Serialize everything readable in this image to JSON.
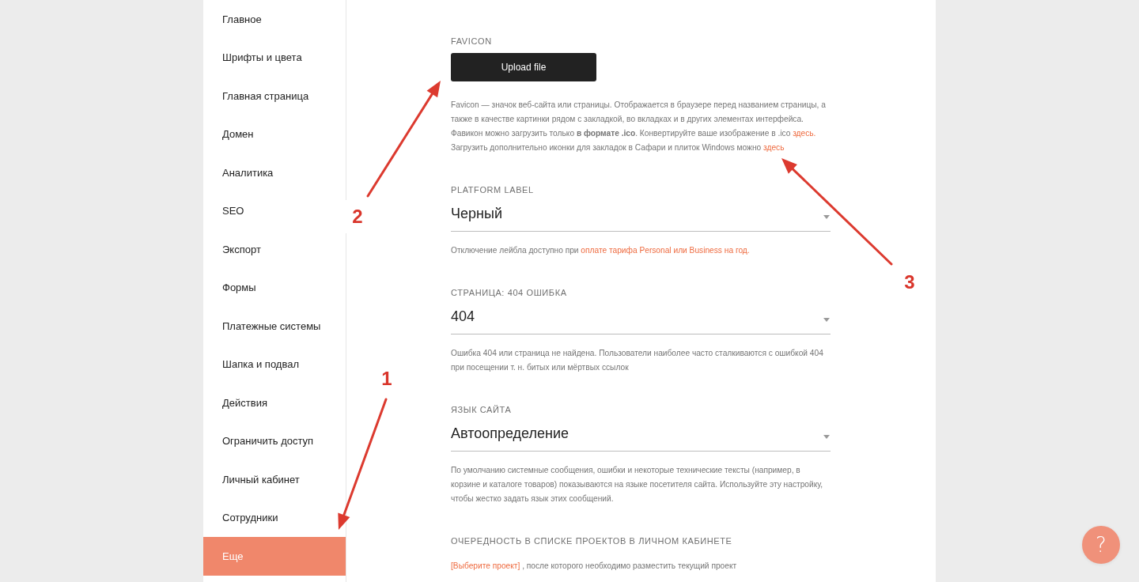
{
  "sidebar": {
    "items": [
      {
        "label": "Главное",
        "selected": false
      },
      {
        "label": "Шрифты и цвета",
        "selected": false
      },
      {
        "label": "Главная страница",
        "selected": false
      },
      {
        "label": "Домен",
        "selected": false
      },
      {
        "label": "Аналитика",
        "selected": false
      },
      {
        "label": "SEO",
        "selected": false
      },
      {
        "label": "Экспорт",
        "selected": false
      },
      {
        "label": "Формы",
        "selected": false
      },
      {
        "label": "Платежные системы",
        "selected": false
      },
      {
        "label": "Шапка и подвал",
        "selected": false
      },
      {
        "label": "Действия",
        "selected": false
      },
      {
        "label": "Ограничить доступ",
        "selected": false
      },
      {
        "label": "Личный кабинет",
        "selected": false
      },
      {
        "label": "Сотрудники",
        "selected": false
      },
      {
        "label": "Еще",
        "selected": true
      }
    ]
  },
  "sections": [
    {
      "kind": "upload",
      "label": "FAVICON",
      "button": "Upload file",
      "paragraphs": [
        [
          {
            "kind": "text",
            "text": "Favicon — значок веб-сайта или страницы. Отображается в браузере перед названием страницы, а также в качестве картинки рядом с закладкой, во вкладках и в других элементах интерфейса. Фавикон можно загрузить только **в формате .ico**. Конвертируйте ваше изображение в .ico "
          },
          {
            "kind": "link",
            "text": "здесь."
          }
        ],
        [
          {
            "kind": "text",
            "text": "Загрузить дополнительно иконки для закладок в Сафари и плиток Windows можно "
          },
          {
            "kind": "link",
            "text": "здесь"
          }
        ]
      ]
    },
    {
      "kind": "select",
      "label": "PLATFORM LABEL",
      "value": "Черный",
      "paragraphs": [
        [
          {
            "kind": "text",
            "text": "Отключение лейбла доступно при "
          },
          {
            "kind": "link",
            "text": "оплате тарифа Personal или Business на год."
          }
        ]
      ]
    },
    {
      "kind": "select",
      "label": "СТРАНИЦА: 404 ОШИБКА",
      "value": "404",
      "paragraphs": [
        [
          {
            "kind": "text",
            "text": "Ошибка 404 или страница не найдена. Пользователи наиболее часто сталкиваются с ошибкой 404 при посещении т. н. битых или мёртвых ссылок"
          }
        ]
      ]
    },
    {
      "kind": "select",
      "label": "ЯЗЫК САЙТА",
      "value": "Автоопределение",
      "paragraphs": [
        [
          {
            "kind": "text",
            "text": "По умолчанию системные сообщения, ошибки и некоторые технические тексты (например, в корзине и каталоге товаров) показываются на языке посетителя сайта. Используйте эту настройку, чтобы жестко задать язык этих сообщений."
          }
        ]
      ]
    },
    {
      "kind": "plain",
      "label": "ОЧЕРЕДНОСТЬ В СПИСКЕ ПРОЕКТОВ В ЛИЧНОМ КАБИНЕТЕ",
      "paragraphs": [
        [
          {
            "kind": "link",
            "text": "[Выберите проект]"
          },
          {
            "kind": "text",
            "text": " , после которого необходимо разместить текущий проект"
          }
        ]
      ]
    }
  ],
  "help_button": {
    "text": "?"
  },
  "annotations": [
    {
      "label": "1"
    },
    {
      "label": "2"
    },
    {
      "label": "3"
    }
  ]
}
